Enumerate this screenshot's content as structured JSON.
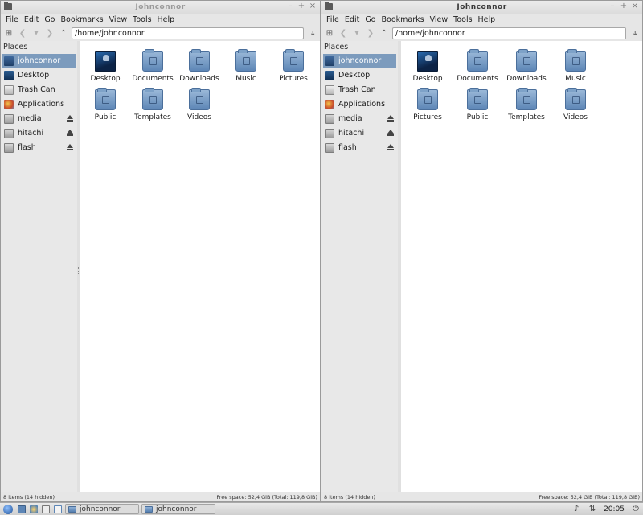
{
  "windows": [
    {
      "title": "Johnconnor",
      "menus": [
        "File",
        "Edit",
        "Go",
        "Bookmarks",
        "View",
        "Tools",
        "Help"
      ],
      "path": "/home/johnconnor",
      "places_header": "Places",
      "places": [
        {
          "label": "johnconnor",
          "icon": "home-folder-icon",
          "selected": true
        },
        {
          "label": "Desktop",
          "icon": "desktop-icon"
        },
        {
          "label": "Trash Can",
          "icon": "trash-icon"
        },
        {
          "label": "Applications",
          "icon": "applications-icon"
        },
        {
          "label": "media",
          "icon": "drive-icon",
          "eject": true
        },
        {
          "label": "hitachi",
          "icon": "drive-icon",
          "eject": true
        },
        {
          "label": "flash",
          "icon": "drive-icon",
          "eject": true
        }
      ],
      "files": [
        {
          "label": "Desktop",
          "icon": "desktop-folder-icon"
        },
        {
          "label": "Documents",
          "icon": "documents-folder-icon"
        },
        {
          "label": "Downloads",
          "icon": "downloads-folder-icon"
        },
        {
          "label": "Music",
          "icon": "music-folder-icon"
        },
        {
          "label": "Pictures",
          "icon": "pictures-folder-icon"
        },
        {
          "label": "Public",
          "icon": "public-folder-icon"
        },
        {
          "label": "Templates",
          "icon": "templates-folder-icon"
        },
        {
          "label": "Videos",
          "icon": "videos-folder-icon"
        }
      ],
      "status_left": "8 items (14 hidden)",
      "status_right": "Free space: 52,4 GiB (Total: 119,8 GiB)"
    },
    {
      "title": "Johnconnor",
      "menus": [
        "File",
        "Edit",
        "Go",
        "Bookmarks",
        "View",
        "Tools",
        "Help"
      ],
      "path": "/home/johnconnor",
      "places_header": "Places",
      "places": [
        {
          "label": "johnconnor",
          "icon": "home-folder-icon",
          "selected": true
        },
        {
          "label": "Desktop",
          "icon": "desktop-icon"
        },
        {
          "label": "Trash Can",
          "icon": "trash-icon"
        },
        {
          "label": "Applications",
          "icon": "applications-icon"
        },
        {
          "label": "media",
          "icon": "drive-icon",
          "eject": true
        },
        {
          "label": "hitachi",
          "icon": "drive-icon",
          "eject": true
        },
        {
          "label": "flash",
          "icon": "drive-icon",
          "eject": true
        }
      ],
      "files": [
        {
          "label": "Desktop",
          "icon": "desktop-folder-icon"
        },
        {
          "label": "Documents",
          "icon": "documents-folder-icon"
        },
        {
          "label": "Downloads",
          "icon": "downloads-folder-icon"
        },
        {
          "label": "Music",
          "icon": "music-folder-icon"
        },
        {
          "label": "Pictures",
          "icon": "pictures-folder-icon"
        },
        {
          "label": "Public",
          "icon": "public-folder-icon"
        },
        {
          "label": "Templates",
          "icon": "templates-folder-icon"
        },
        {
          "label": "Videos",
          "icon": "videos-folder-icon"
        }
      ],
      "status_left": "8 items (14 hidden)",
      "status_right": "Free space: 52,4 GiB (Total: 119,8 GiB)"
    }
  ],
  "taskbar": {
    "tasks": [
      {
        "label": "johnconnor"
      },
      {
        "label": "johnconnor"
      }
    ],
    "clock": "20:05"
  },
  "colors": {
    "selection": "#7c9bbd",
    "folder": "#6e94c0"
  }
}
